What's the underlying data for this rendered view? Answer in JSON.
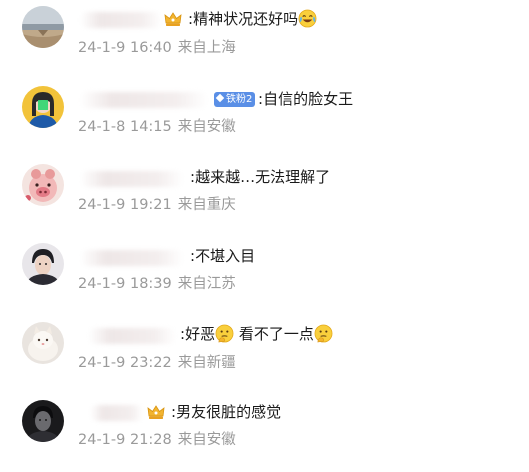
{
  "comments": [
    {
      "text": "精神状况还好吗",
      "date": "24-1-9 16:40",
      "location": "来自上海",
      "emoji": "laughing-crying-emoji"
    },
    {
      "text": "自信的脸女王",
      "date": "24-1-8 14:15",
      "location": "来自安徽",
      "badge": "铁粉2"
    },
    {
      "text": "越来越…无法理解了",
      "date": "24-1-9 19:21",
      "location": "来自重庆"
    },
    {
      "text": "不堪入目",
      "date": "24-1-9 18:39",
      "location": "来自江苏"
    },
    {
      "text_part1": "好恶",
      "text_part2": "看不了一点",
      "date": "24-1-9 23:22",
      "location": "来自新疆",
      "emoji": "thinking-emoji"
    },
    {
      "text": "男友很脏的感觉",
      "date": "24-1-9 21:28",
      "location": "来自安徽"
    }
  ],
  "colors": {
    "meta_text": "#9a9a9a",
    "content_text": "#1a1a1a",
    "fan_badge": "#5a8fe6",
    "crown": "#f2b430"
  }
}
